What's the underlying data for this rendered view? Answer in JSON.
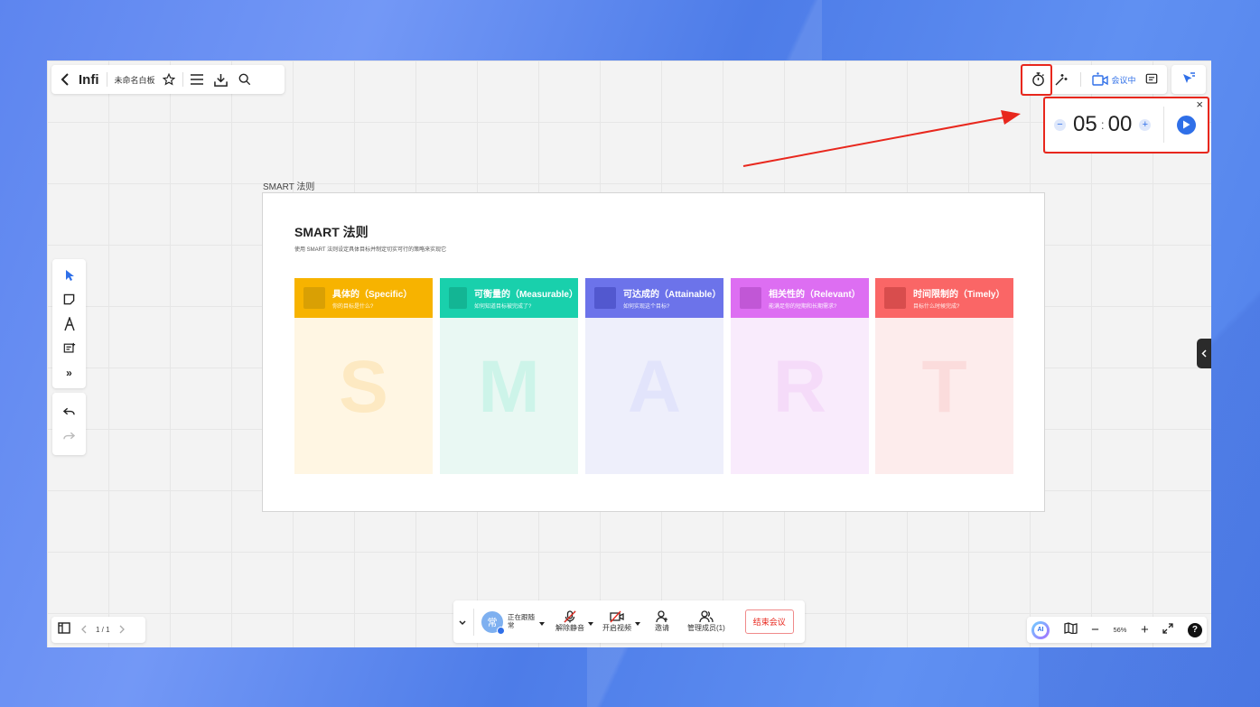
{
  "toolbar": {
    "back_icon": "chevron-left-icon",
    "brand": "Infi",
    "board_title": "未命名白板",
    "star_icon": "star-icon",
    "menu_icon": "menu-icon",
    "download_icon": "download-icon",
    "search_icon": "search-icon"
  },
  "top_right": {
    "timer_icon": "stopwatch-icon",
    "magic_icon": "magic-wand-icon",
    "meeting_label": "会议中",
    "comment_icon": "comment-icon",
    "cursor_icon": "pointer-follow-icon"
  },
  "timer": {
    "minutes": "05",
    "seconds": "00",
    "separator": ":",
    "minus": "−",
    "plus": "+",
    "close": "×",
    "play_icon": "play-icon"
  },
  "frame": {
    "label": "SMART 法则",
    "title": "SMART 法则",
    "subtitle": "使用 SMART 法则设定具体目标并制定切实可行的策略来实现它"
  },
  "cards": [
    {
      "title": "具体的（Specific）",
      "sub": "你的目标是什么?",
      "letter": "S",
      "color": "#f7b300",
      "bg": "#fff6e3",
      "letter_color": "#fde9c2",
      "sq": "#d9a004"
    },
    {
      "title": "可衡量的（Measurable）",
      "sub": "如何知道目标被完成了?",
      "letter": "M",
      "color": "#19d0ac",
      "bg": "#e9f8f3",
      "letter_color": "#cdf4e9",
      "sq": "#13b594"
    },
    {
      "title": "可达成的（Attainable）",
      "sub": "如何实现这个目标?",
      "letter": "A",
      "color": "#6c73ea",
      "bg": "#eeeffb",
      "letter_color": "#e2e4fb",
      "sq": "#5258cf"
    },
    {
      "title": "相关性的（Relevant）",
      "sub": "能满足你的短期和长期需求?",
      "letter": "R",
      "color": "#dd6ef2",
      "bg": "#f9ebfc",
      "letter_color": "#f5dbf9",
      "sq": "#c157d6"
    },
    {
      "title": "时间限制的（Timely）",
      "sub": "目标什么时候完成?",
      "letter": "T",
      "color": "#fa6666",
      "bg": "#fdecec",
      "letter_color": "#fbdcdc",
      "sq": "#d84d4d"
    }
  ],
  "tools": [
    "cursor-icon",
    "sticky-note-icon",
    "pen-icon",
    "text-card-icon",
    "more-icon"
  ],
  "history": [
    "undo-icon",
    "redo-icon"
  ],
  "page_nav": {
    "page": "1 / 1"
  },
  "meeting_bar": {
    "avatar_text": "常",
    "status": "正在跟随",
    "status2": "常",
    "unmute": "解除静音",
    "video": "开启视频",
    "invite": "邀请",
    "members": "管理成员(1)",
    "end": "结束会议"
  },
  "zoom": {
    "ai": "AI",
    "minus": "−",
    "value": "56%",
    "plus": "+",
    "help": "?"
  }
}
